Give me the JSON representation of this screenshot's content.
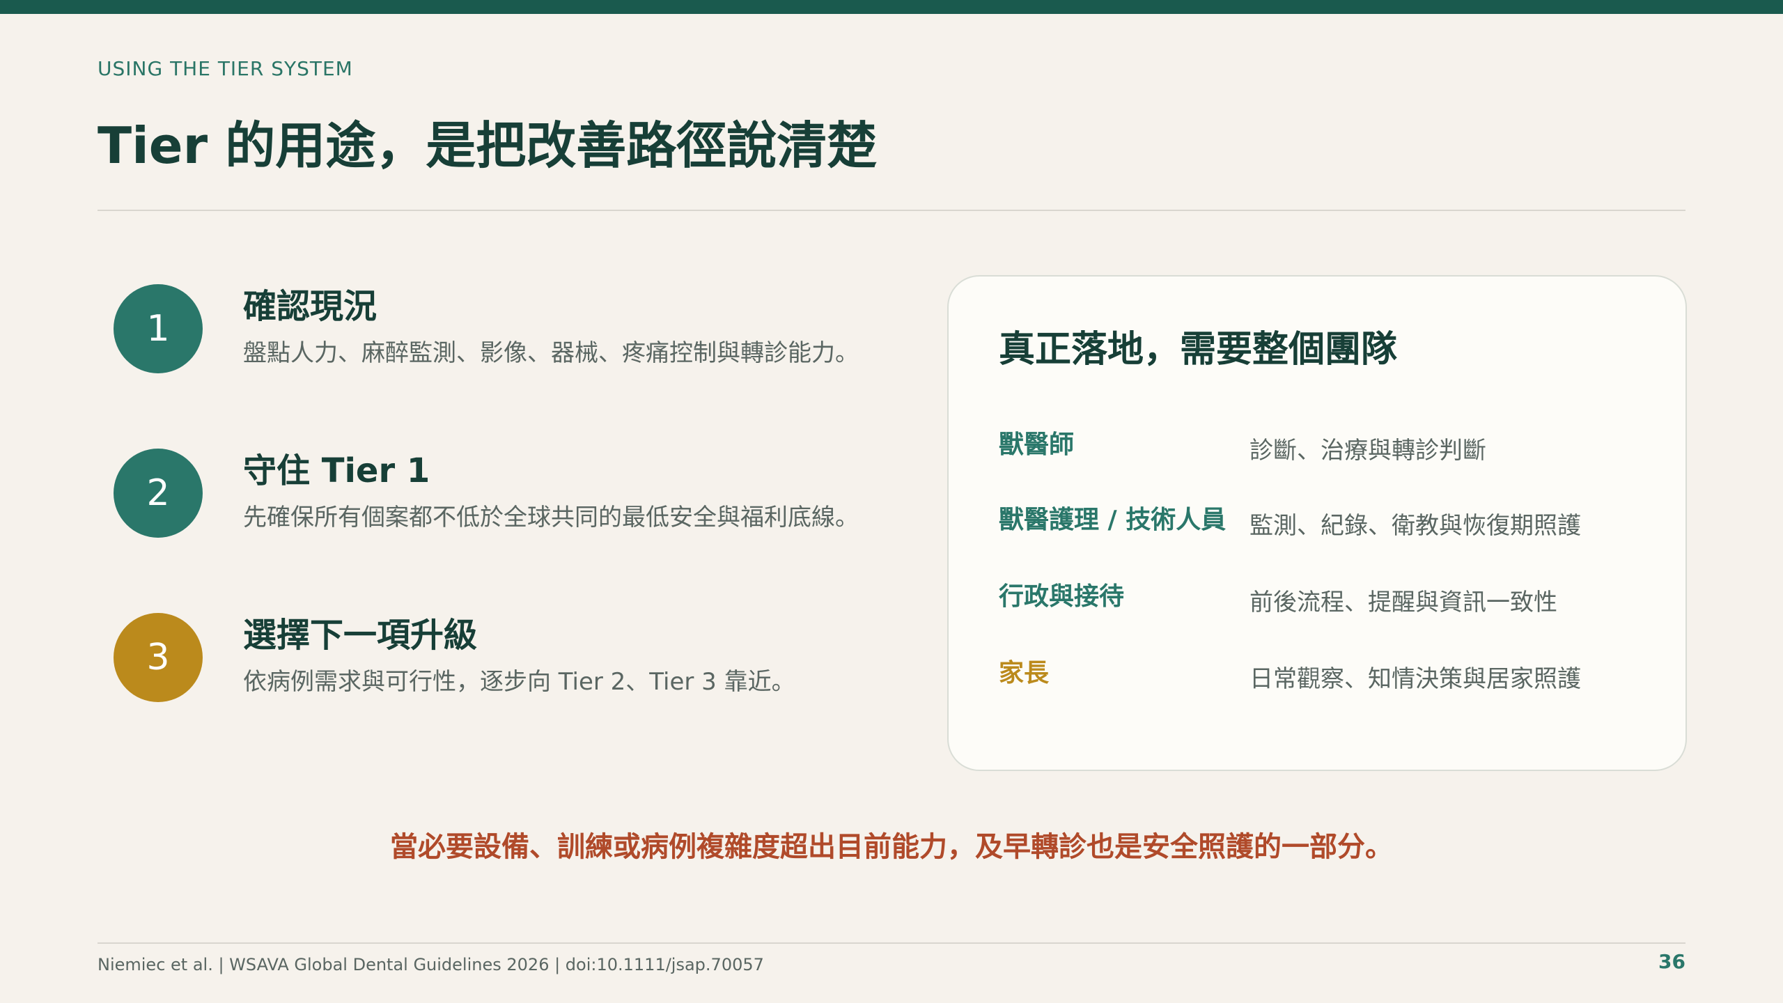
{
  "slide": {
    "eyebrow": "USING THE TIER SYSTEM",
    "title": "Tier 的用途，是把改善路徑說清楚",
    "steps": [
      {
        "number": "1",
        "title": "確認現況",
        "desc": "盤點人力、麻醉監測、影像、器械、疼痛控制與轉診能力。"
      },
      {
        "number": "2",
        "title": "守住 Tier 1",
        "desc": "先確保所有個案都不低於全球共同的最低安全與福利底線。"
      },
      {
        "number": "3",
        "title": "選擇下一項升級",
        "desc": "依病例需求與可行性，逐步向 Tier 2、Tier 3 靠近。"
      }
    ],
    "team_card": {
      "title": "真正落地，需要整個團隊",
      "rows": [
        {
          "role": "獸醫師",
          "responsibility": "診斷、治療與轉診判斷"
        },
        {
          "role": "獸醫護理 / 技術人員",
          "responsibility": "監測、紀錄、衛教與恢復期照護"
        },
        {
          "role": "行政與接待",
          "responsibility": "前後流程、提醒與資訊一致性"
        },
        {
          "role": "家長",
          "responsibility": "日常觀察、知情決策與居家照護"
        }
      ]
    },
    "callout": "當必要設備、訓練或病例複雜度超出目前能力，及早轉診也是安全照護的一部分。",
    "footer": "Niemiec et al. | WSAVA Global Dental Guidelines 2026 | doi:10.1111/jsap.70057",
    "page_number": "36"
  },
  "colors": {
    "background": "#f6f2ec",
    "primary_green": "#2a776a",
    "dark_green": "#173f37",
    "gold": "#bb8a1c",
    "callout_red": "#b04a2a",
    "top_bar": "#1a5a4e"
  }
}
